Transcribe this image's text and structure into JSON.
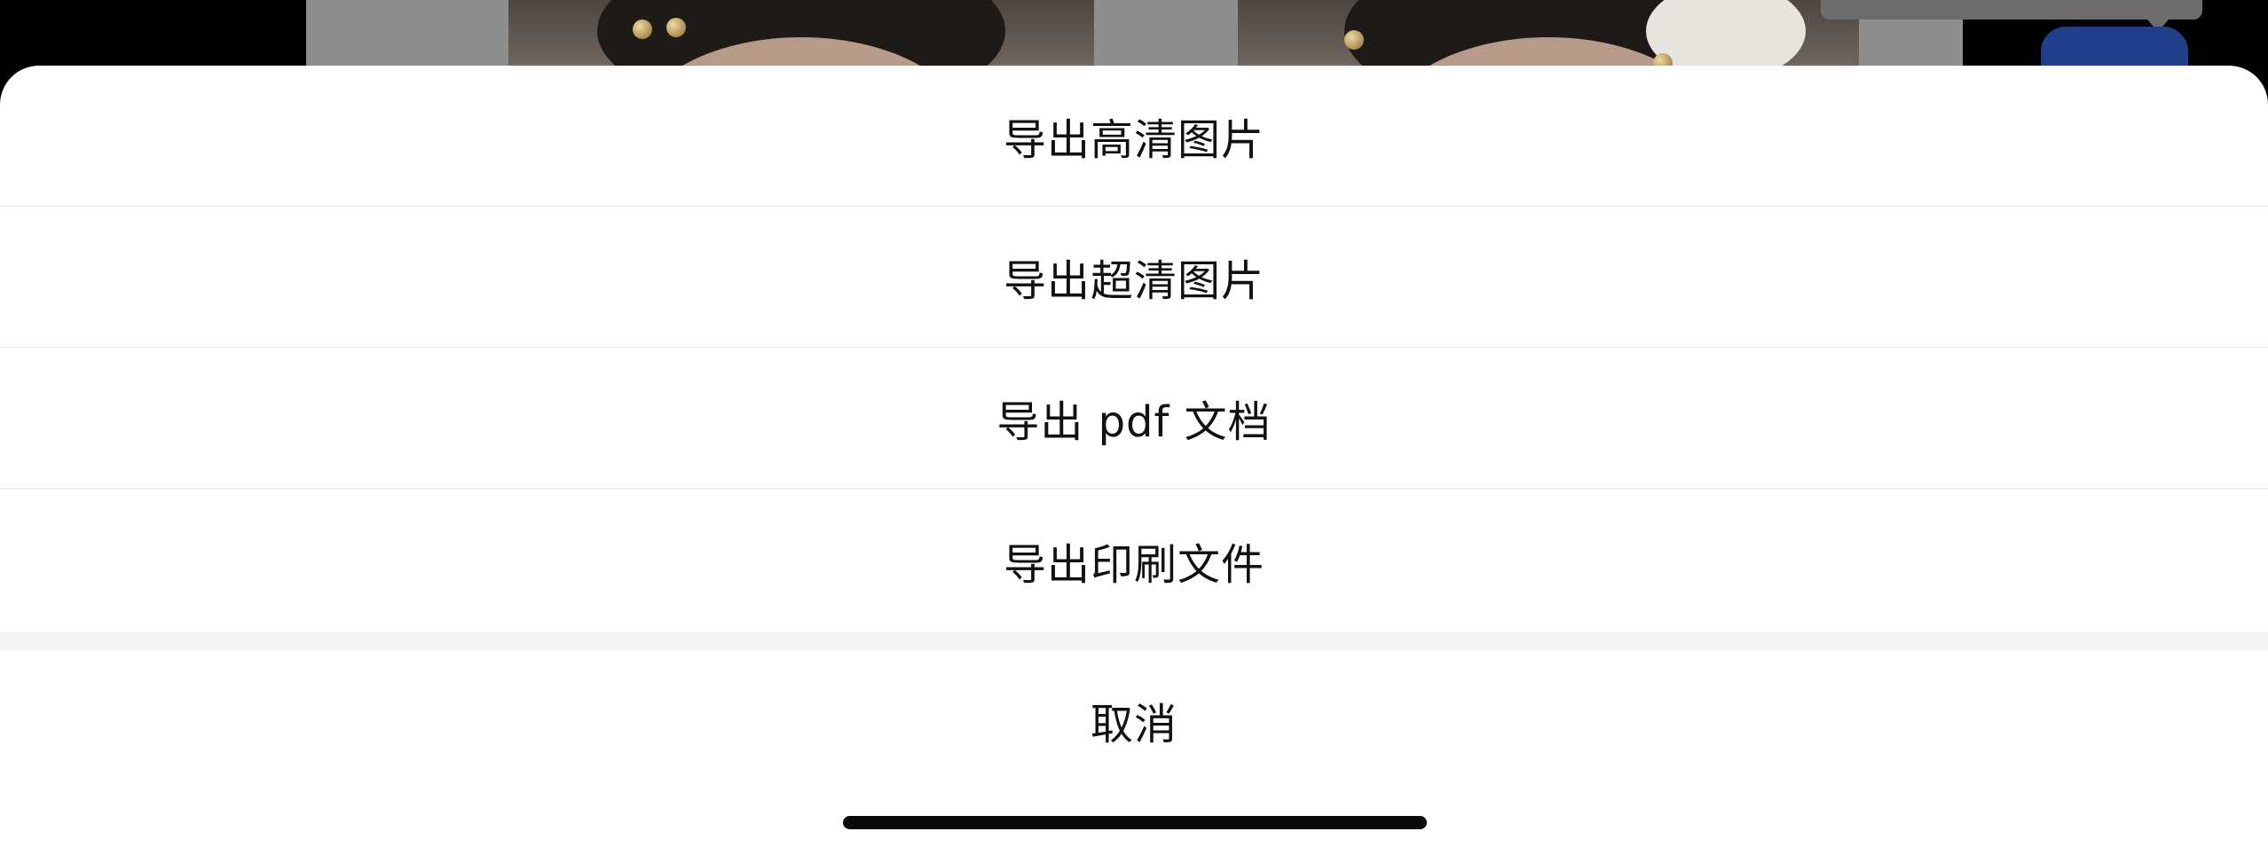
{
  "background": {
    "canvas_color": "#8e8e8e",
    "fab_color": "#1f3f8a"
  },
  "action_sheet": {
    "items": [
      {
        "label": "导出高清图片"
      },
      {
        "label": "导出超清图片"
      },
      {
        "label": "导出 pdf 文档"
      },
      {
        "label": "导出印刷文件"
      }
    ],
    "cancel_label": "取消",
    "background_color": "#ffffff",
    "separator_color": "#f5f5f5",
    "text_color": "#111111"
  }
}
